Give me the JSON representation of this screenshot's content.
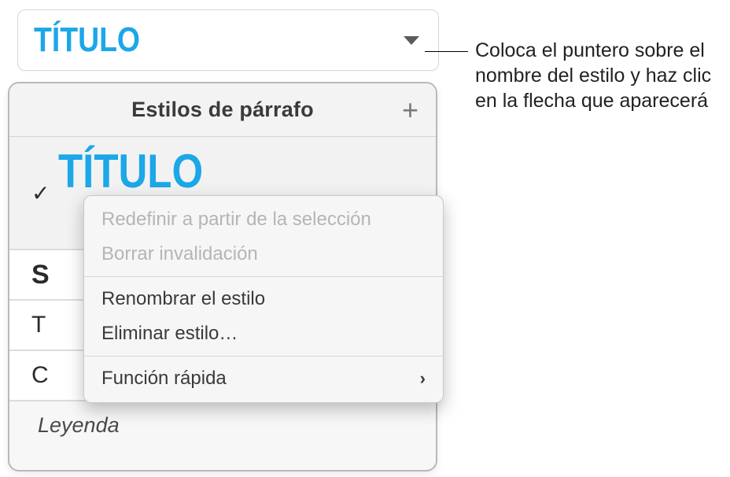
{
  "style_button": {
    "label": "Título"
  },
  "popover": {
    "title": "Estilos de párrafo",
    "selected_style": "Título",
    "visible_items": {
      "s": "S",
      "t": "T",
      "c": "C",
      "caption": "Leyenda"
    }
  },
  "context_menu": {
    "redefine": "Redefinir a partir de la selección",
    "clear_override": "Borrar invalidación",
    "rename": "Renombrar el estilo",
    "delete": "Eliminar estilo…",
    "shortcut": "Función rápida"
  },
  "callout": {
    "text": "Coloca el puntero sobre el nombre del estilo y haz clic en la flecha que aparecerá"
  }
}
